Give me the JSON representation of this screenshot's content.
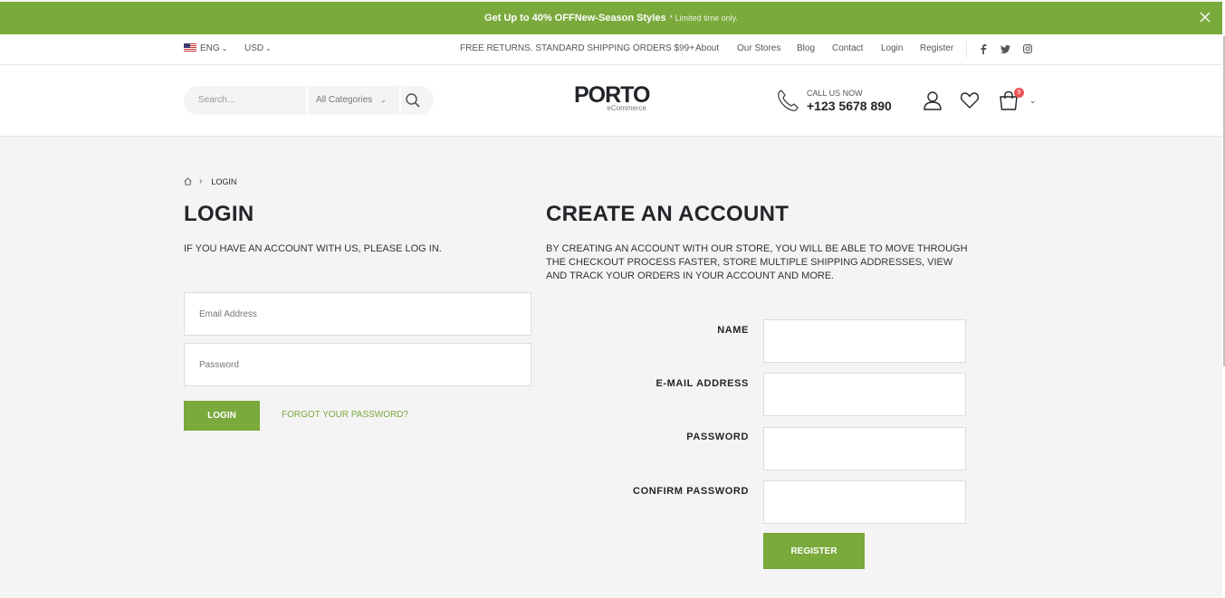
{
  "promo": {
    "prefix": "Get Up to ",
    "highlight": "40% OFF",
    "suffix": " New-Season Styles",
    "note": "* Limited time only."
  },
  "topbar": {
    "language": "ENG",
    "currency": "USD",
    "shipping": "FREE RETURNS. STANDARD SHIPPING ORDERS $99+",
    "links": [
      "About",
      "Our Stores",
      "Blog",
      "Contact",
      "Login",
      "Register"
    ],
    "social": [
      "facebook-icon",
      "twitter-icon",
      "instagram-icon"
    ]
  },
  "header": {
    "search_placeholder": "Search...",
    "category": "All Categories",
    "logo_main": "PORTO",
    "logo_sub": "eCommerce",
    "call_label": "CALL US NOW",
    "phone": "+123 5678 890",
    "cart_count": "9"
  },
  "breadcrumb": {
    "current": "LOGIN"
  },
  "login": {
    "title": "LOGIN",
    "description": "IF YOU HAVE AN ACCOUNT WITH US, PLEASE LOG IN.",
    "email_placeholder": "Email Address",
    "password_placeholder": "Password",
    "button": "LOGIN",
    "forgot": "FORGOT YOUR PASSWORD?"
  },
  "register": {
    "title": "CREATE AN ACCOUNT",
    "description": "BY CREATING AN ACCOUNT WITH OUR STORE, YOU WILL BE ABLE TO MOVE THROUGH THE CHECKOUT PROCESS FASTER, STORE MULTIPLE SHIPPING ADDRESSES, VIEW AND TRACK YOUR ORDERS IN YOUR ACCOUNT AND MORE.",
    "name_label": "NAME",
    "email_label": "E-MAIL ADDRESS",
    "password_label": "PASSWORD",
    "confirm_label": "CONFIRM PASSWORD",
    "button": "REGISTER"
  },
  "colors": {
    "accent": "#7aa93c",
    "dark": "#222529",
    "badge": "#ee5151"
  }
}
